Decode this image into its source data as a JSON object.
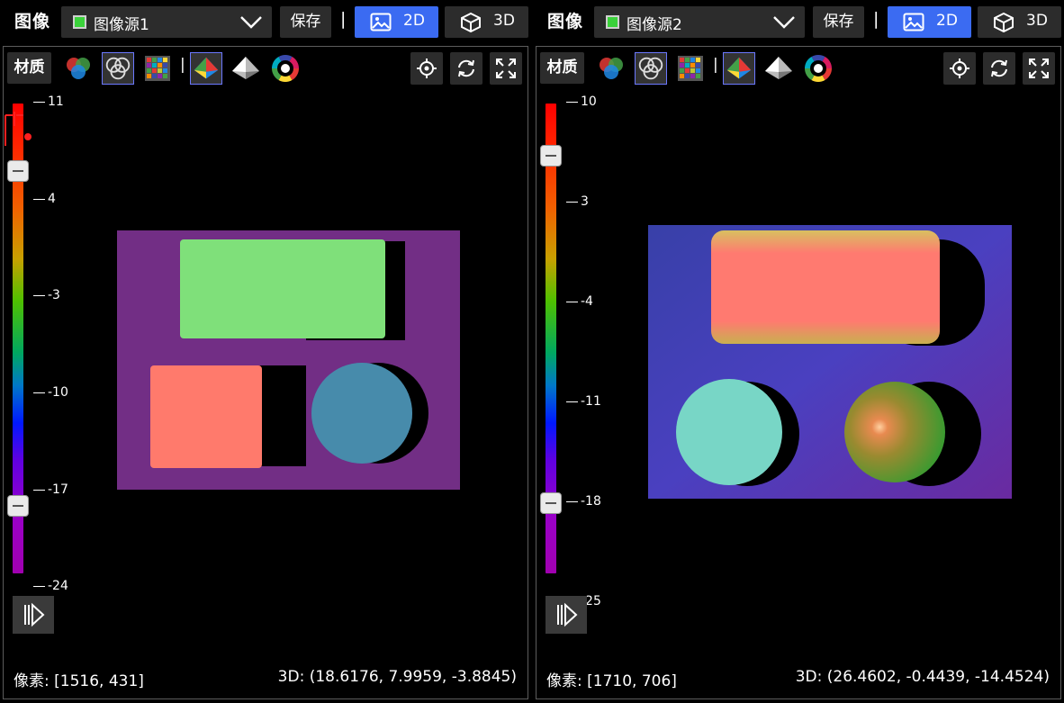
{
  "panels": [
    {
      "title": "图像",
      "source": "图像源1",
      "save_label": "保存",
      "divider": "|",
      "btn_2d": "2D",
      "btn_3d": "3D",
      "material_label": "材质",
      "toolbar_sep": "|",
      "colorbar_ticks": [
        "11",
        "4",
        "-3",
        "-10",
        "-17",
        "-24"
      ],
      "status_pixel": "像素: [1516, 431]",
      "status_3d": "3D: (18.6176, 7.9959, -3.8845)"
    },
    {
      "title": "图像",
      "source": "图像源2",
      "save_label": "保存",
      "divider": "|",
      "btn_2d": "2D",
      "btn_3d": "3D",
      "material_label": "材质",
      "toolbar_sep": "|",
      "colorbar_ticks": [
        "10",
        "3",
        "-4",
        "-11",
        "-18",
        "-25"
      ],
      "status_pixel": "像素: [1710, 706]",
      "status_3d": "3D: (26.4602, -0.4439, -14.4524)"
    }
  ],
  "colors": {
    "accent": "#3b6bf2",
    "button_bg": "#2c2c2c",
    "frame_border": "#5c5c5c",
    "source_indicator": "#3bd23b"
  },
  "icons": {
    "dropdown": "chevron-down-icon",
    "btn_2d": "image-icon",
    "btn_3d": "cube-icon",
    "toolbar": [
      "rgb-color-icon",
      "rgb-outline-icon",
      "color-grid-icon",
      "height-map-icon",
      "gray-shading-icon",
      "color-wheel-icon"
    ],
    "toolbar_right": [
      "locate-icon",
      "refresh-icon",
      "fullscreen-icon"
    ],
    "play": "play-icon"
  }
}
